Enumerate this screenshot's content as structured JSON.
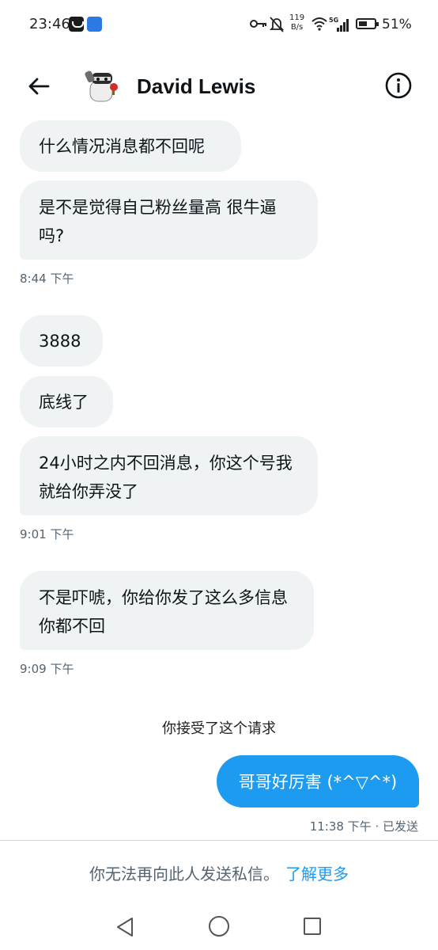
{
  "status_bar": {
    "time": "23:46",
    "net_speed_value": "119",
    "net_speed_unit": "B/s",
    "signal_label": "5G",
    "battery_percent": "51%"
  },
  "header": {
    "contact_name": "David Lewis",
    "back_icon": "arrow-left-icon",
    "info_icon": "info-icon"
  },
  "messages": [
    {
      "text": "什么情况消息都不回呢"
    },
    {
      "text": "是不是觉得自己粉丝量高 很牛逼吗?"
    },
    {
      "time": "8:44 下午"
    },
    {
      "text": "3888"
    },
    {
      "text": "底线了"
    },
    {
      "text": "24小时之内不回消息，你这个号我就给你弄没了"
    },
    {
      "time": "9:01 下午"
    },
    {
      "text": "不是吓唬，你给你发了这么多信息你都不回"
    },
    {
      "time": "9:09 下午"
    }
  ],
  "system_message": "你接受了这个请求",
  "outgoing": {
    "text": "哥哥好厉害 (*^▽^*)",
    "status": "11:38 下午 · 已发送"
  },
  "footer": {
    "notice": "你无法再向此人发送私信。",
    "learn_more": "了解更多"
  },
  "colors": {
    "accent": "#1d9bf0",
    "incoming_bubble": "#eff3f4",
    "secondary_text": "#536471"
  }
}
